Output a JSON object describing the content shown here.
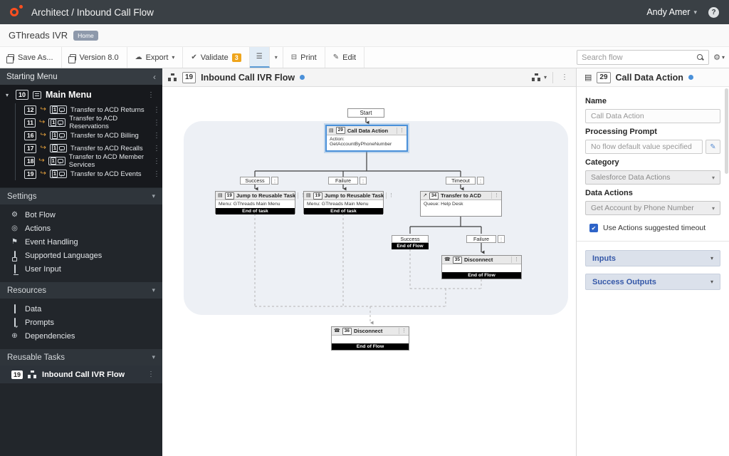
{
  "topbar": {
    "app_title": "Architect / Inbound Call Flow",
    "user_name": "Andy Amer",
    "help_glyph": "?"
  },
  "titlebar": {
    "flow_name": "GThreads IVR",
    "home_badge": "Home"
  },
  "toolbar": {
    "save_as": "Save As...",
    "version": "Version 8.0",
    "export": "Export",
    "validate": "Validate",
    "validate_count": "3",
    "print": "Print",
    "edit": "Edit",
    "search_placeholder": "Search flow"
  },
  "icons": {
    "kebab": "⋮",
    "caret_down": "▾",
    "collapse_left": "‹",
    "check": "✔",
    "pencil": "✎",
    "gear": "⚙",
    "cloud": "☁",
    "list": "☰",
    "print_box": "⊟",
    "jump": "↪",
    "flag": "⚑",
    "gears": "⚙",
    "circle": "◎",
    "db": "▤",
    "phone": "☎",
    "external": "↗",
    "plus_circle": "⊕"
  },
  "sidebar": {
    "starting_menu_title": "Starting Menu",
    "main_menu": {
      "id": "10",
      "label": "Main Menu"
    },
    "menu_items": [
      {
        "id": "12",
        "one": "1",
        "label": "Transfer to ACD Returns"
      },
      {
        "id": "11",
        "one": "1",
        "label": "Transfer to ACD Reservations"
      },
      {
        "id": "16",
        "one": "1",
        "label": "Transfer to ACD Billing"
      },
      {
        "id": "17",
        "one": "1",
        "label": "Transfer to ACD Recalls"
      },
      {
        "id": "18",
        "one": "1",
        "label": "Transfer to ACD Member Services"
      },
      {
        "id": "19",
        "one": "1",
        "label": "Transfer to ACD Events"
      }
    ],
    "settings": {
      "title": "Settings",
      "items": [
        "Bot Flow",
        "Actions",
        "Event Handling",
        "Supported Languages",
        "User Input"
      ]
    },
    "resources": {
      "title": "Resources",
      "items": [
        "Data",
        "Prompts",
        "Dependencies"
      ]
    },
    "reusable_tasks": {
      "title": "Reusable Tasks",
      "item": {
        "id": "19",
        "label": "Inbound Call IVR Flow"
      }
    }
  },
  "flow": {
    "header": {
      "id": "19",
      "title": "Inbound Call IVR Flow"
    },
    "start_label": "Start",
    "branches": {
      "success": "Success",
      "failure": "Failure",
      "timeout": "Timeout",
      "success2": "Success",
      "failure2": "Failure",
      "end_of_flow": "End of Flow"
    },
    "nodes": {
      "cda": {
        "id": "29",
        "title": "Call Data Action",
        "body": "Action: GetAccountByPhoneNumber"
      },
      "jump1": {
        "id": "19",
        "title": "Jump to Reusable Task",
        "body": "Menu: GThreads Main Menu",
        "footer": "End of task"
      },
      "jump2": {
        "id": "19",
        "title": "Jump to Reusable Task",
        "body": "Menu: GThreads Main Menu",
        "footer": "End of task"
      },
      "acd": {
        "id": "34",
        "title": "Transfer to ACD",
        "body": "Queue: Help Desk"
      },
      "disc35": {
        "id": "35",
        "title": "Disconnect",
        "footer": "End of Flow"
      },
      "disc36": {
        "id": "36",
        "title": "Disconnect",
        "footer": "End of Flow"
      }
    }
  },
  "panel": {
    "header": {
      "id": "29",
      "title": "Call Data Action"
    },
    "name_label": "Name",
    "name_value": "Call Data Action",
    "processing_prompt_label": "Processing Prompt",
    "processing_prompt_value": "No flow default value specified",
    "category_label": "Category",
    "category_value": "Salesforce Data Actions",
    "data_actions_label": "Data Actions",
    "data_actions_value": "Get Account by Phone Number",
    "timeout_checkbox_label": "Use Actions suggested timeout",
    "accordions": [
      {
        "label": "Inputs"
      },
      {
        "label": "Success Outputs"
      }
    ]
  },
  "colors": {
    "brand_orange": "#ff4f1f",
    "validate_badge": "#efa51c",
    "selection_blue": "#4a90d9",
    "accent_blue": "#3558a8"
  }
}
